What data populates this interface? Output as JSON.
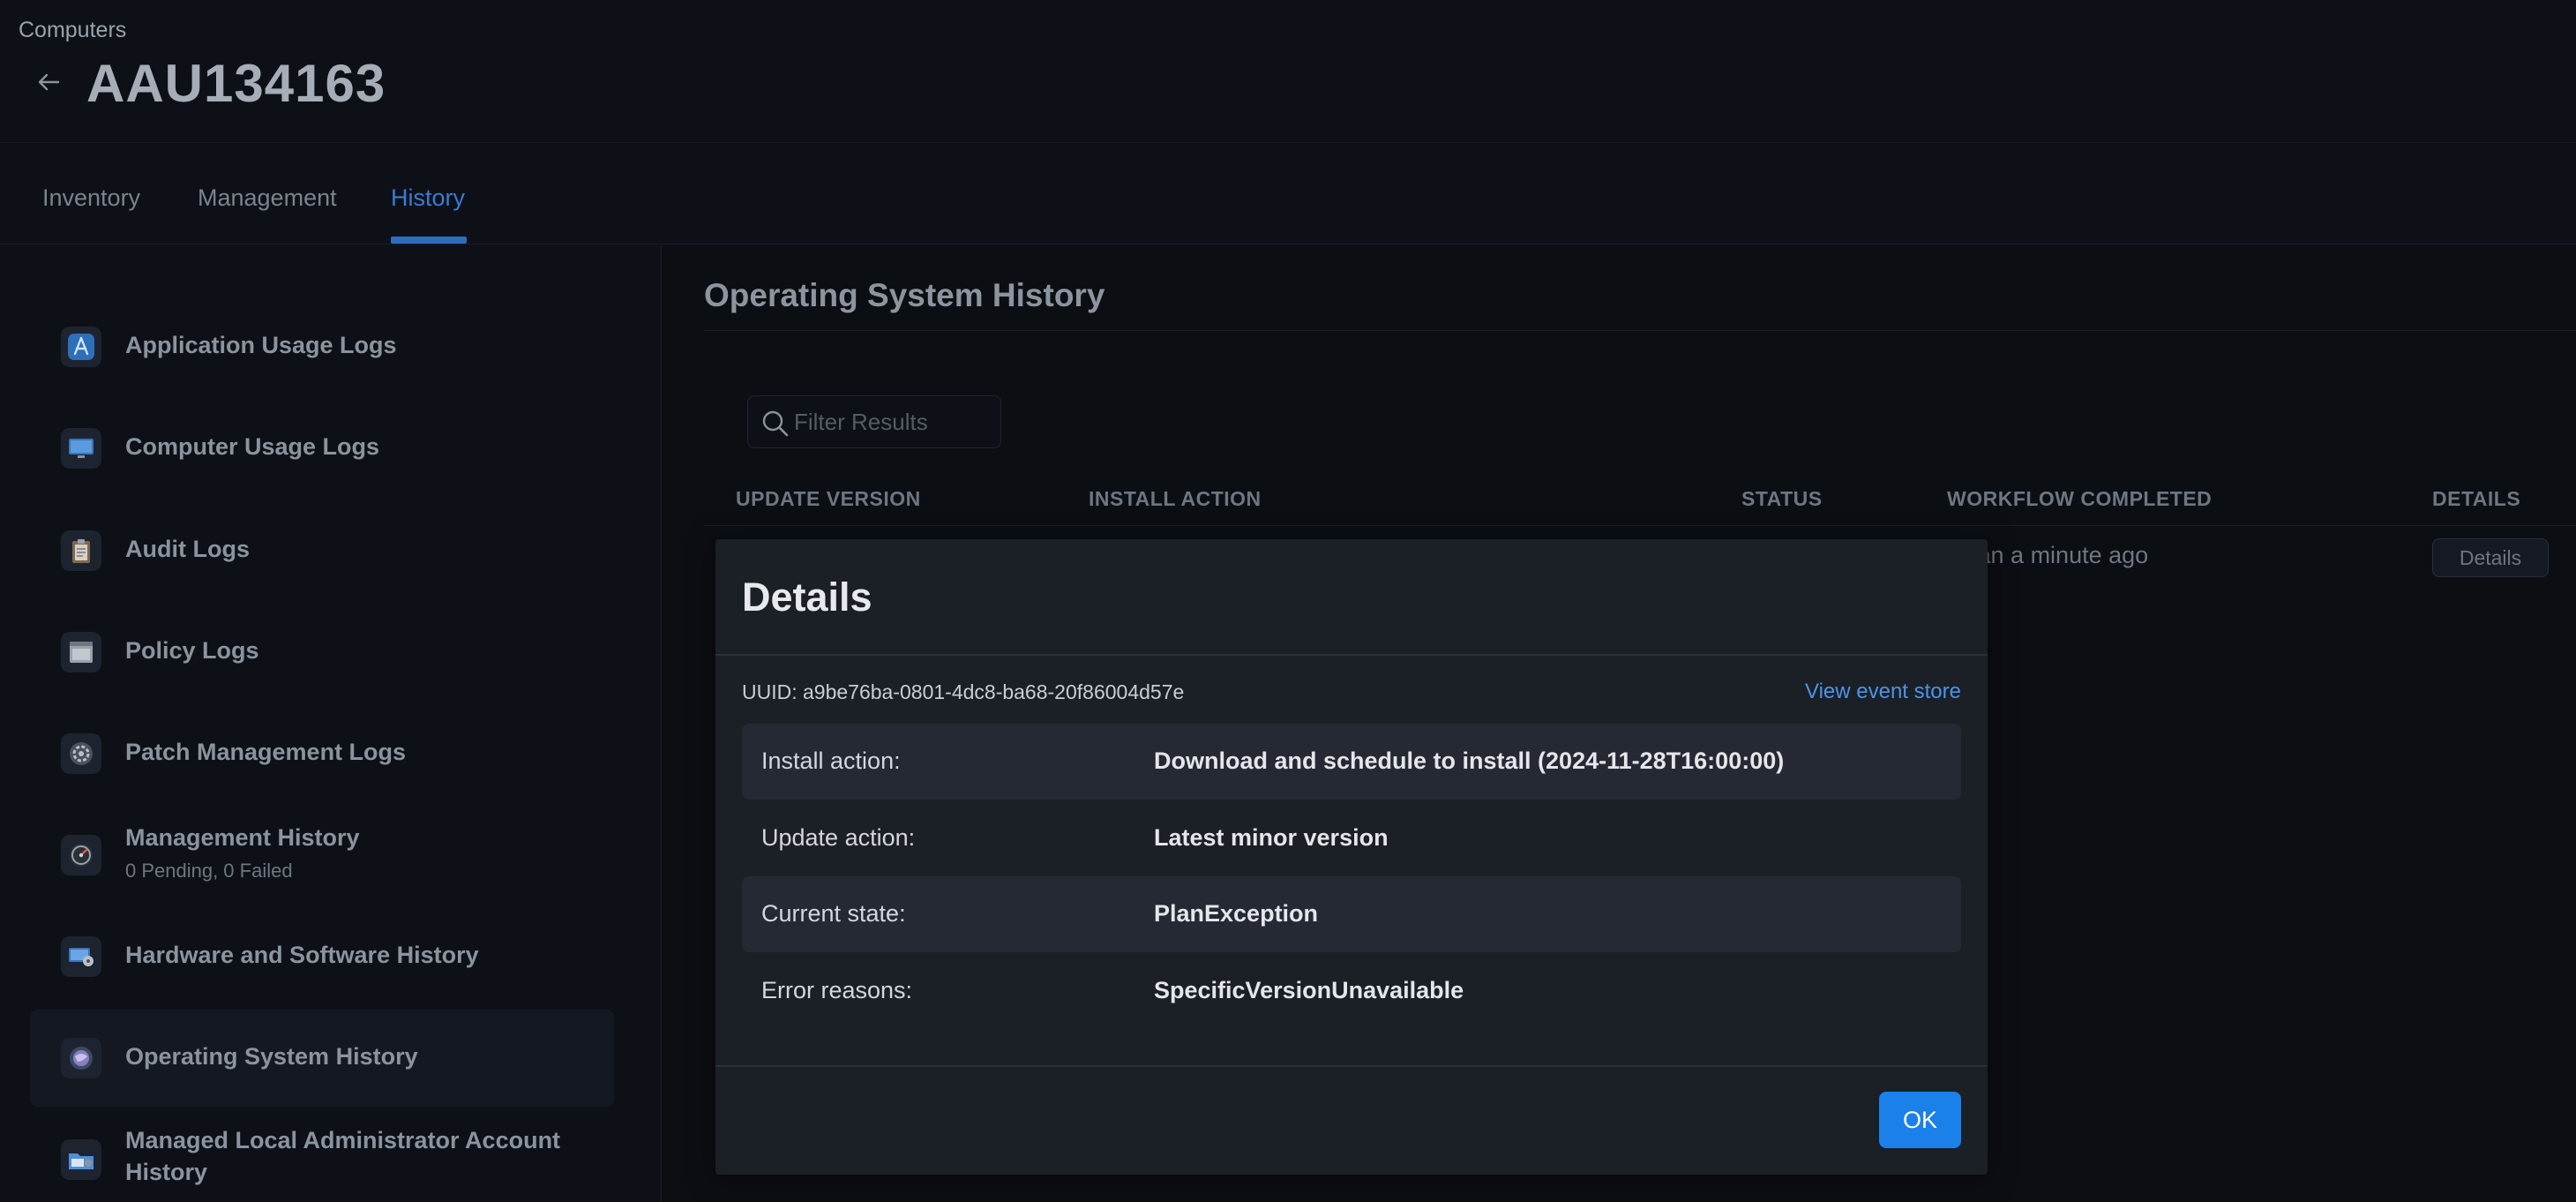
{
  "header": {
    "breadcrumb": "Computers",
    "title": "AAU134163"
  },
  "tabs": [
    {
      "label": "Inventory"
    },
    {
      "label": "Management"
    },
    {
      "label": "History",
      "active": true
    }
  ],
  "sidebar": {
    "items": [
      {
        "label": "Application Usage Logs",
        "icon": "app-store-icon"
      },
      {
        "label": "Computer Usage Logs",
        "icon": "monitor-icon"
      },
      {
        "label": "Audit Logs",
        "icon": "clipboard-icon"
      },
      {
        "label": "Policy Logs",
        "icon": "window-icon"
      },
      {
        "label": "Patch Management Logs",
        "icon": "gear-badge-icon"
      },
      {
        "label": "Management History",
        "sublabel": "0 Pending, 0 Failed",
        "icon": "gauge-icon"
      },
      {
        "label": "Hardware and Software History",
        "icon": "display-gear-icon"
      },
      {
        "label": "Operating System History",
        "icon": "os-icon",
        "selected": true
      },
      {
        "label_line1": "Managed Local Administrator Account",
        "label_line2": "History",
        "icon": "admin-folder-icon"
      }
    ]
  },
  "main": {
    "section_title": "Operating System History",
    "filter_placeholder": "Filter Results",
    "columns": [
      "UPDATE VERSION",
      "INSTALL ACTION",
      "STATUS",
      "WORKFLOW COMPLETED",
      "DETAILS"
    ],
    "rows": [
      {
        "workflow_completed_partial": "s than a minute ago",
        "details_label": "Details"
      }
    ]
  },
  "modal": {
    "title": "Details",
    "uuid": "UUID: a9be76ba-0801-4dc8-ba68-20f86004d57e",
    "event_link": "View event store",
    "fields": [
      {
        "label": "Install action:",
        "value": "Download and schedule to install (2024-11-28T16:00:00)"
      },
      {
        "label": "Update action:",
        "value": "Latest minor version"
      },
      {
        "label": "Current state:",
        "value": "PlanException"
      },
      {
        "label": "Error reasons:",
        "value": "SpecificVersionUnavailable"
      }
    ],
    "ok_label": "OK"
  },
  "colors": {
    "accent": "#1a80ea",
    "link": "#4c94e8",
    "tab_active": "#3a7bd5"
  }
}
